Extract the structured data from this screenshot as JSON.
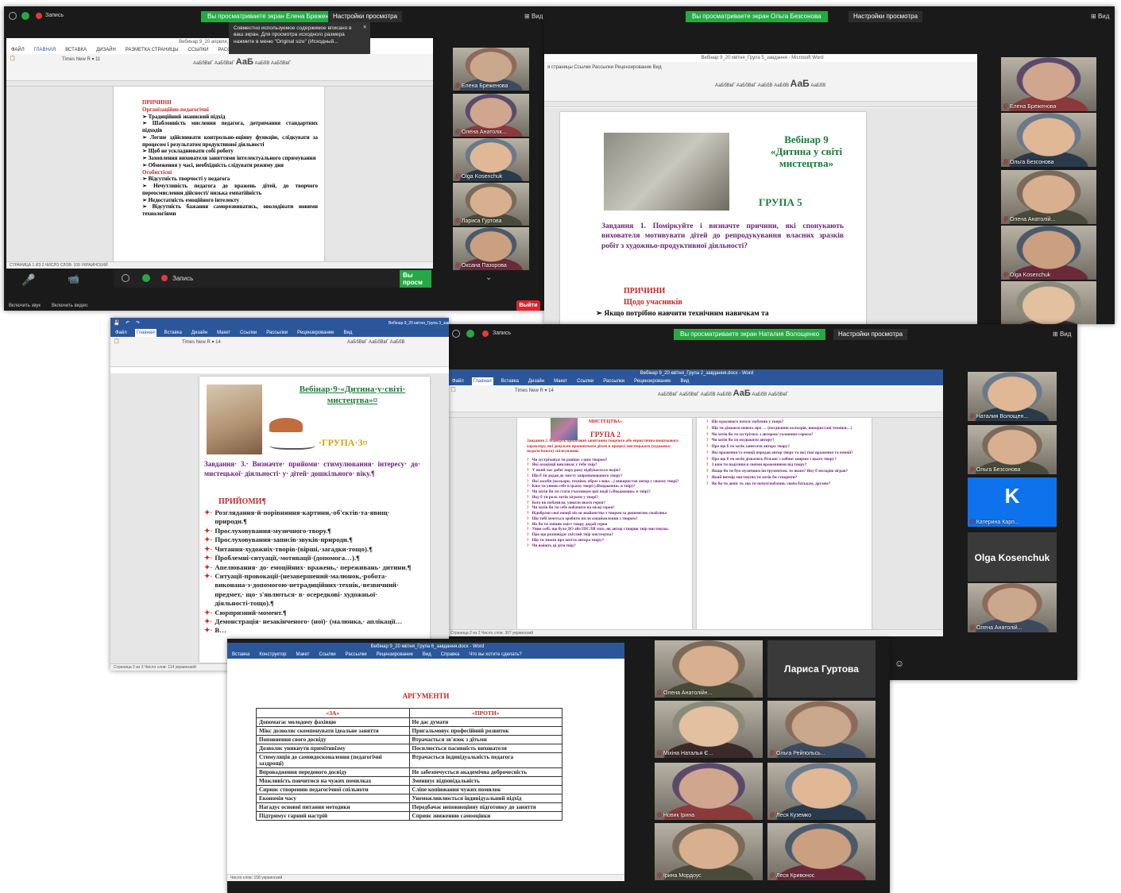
{
  "zoom": {
    "banner_prefix": "Ви просматриваете экран",
    "view_label": "Вид",
    "view_settings": "Настройки просмотра",
    "record": "Запись",
    "exit": "Выйти",
    "reactions": "акции",
    "mute": "Включить звук",
    "video": "Включить видео",
    "tooltip": "Совместно используемое содержимое вписано в ваш экран. Для просмотра исходного размера нажмите в меню \"Original size\" (Исходный..."
  },
  "win1": {
    "banner": "Вы просматриваете экран Елена Бреженова",
    "doc_title": "Вебинар 9_20 апреля, группа 4 - Word",
    "tabs": [
      "ФАЙЛ",
      "ГЛАВНАЯ",
      "ВСТАВКА",
      "ДИЗАЙН",
      "РАЗМЕТКА СТРАНИЦЫ",
      "ССЫЛКИ",
      "РАССЫЛКИ",
      "РЕЦЕНЗИРОВАНИЕ",
      "ВИД"
    ],
    "doc_lines": [
      {
        "t": "ПРИЧИНИ",
        "c": "red"
      },
      {
        "t": "Організаційно-педагогічні",
        "c": "red"
      },
      {
        "t": "➢  Традиційний знаннєвий підхід",
        "c": ""
      },
      {
        "t": "➢  Шаблонність мислення педагога, дотримання стандартних підходів",
        "c": ""
      },
      {
        "t": "➢  Легше здійснювати контрольно-оцінну функцію, слідкувати за процесом і результатом продуктивної діяльності",
        "c": ""
      },
      {
        "t": "➢  Щоб не ускладнювати собі роботу",
        "c": ""
      },
      {
        "t": "➢  Захоплення вихователя заняттями інтелектуального спрямування",
        "c": ""
      },
      {
        "t": "➢  Обмеження у часі, необхідність слідувати режиму дня",
        "c": ""
      },
      {
        "t": "Особистісні",
        "c": "red"
      },
      {
        "t": "➢  Відсутність творчості у педагога",
        "c": ""
      },
      {
        "t": "➢  Нечутливість педагога до вражень дітей, до творчого переосмислення дійсності/ низька емпатійність",
        "c": ""
      },
      {
        "t": "➢  Недостатність емоційного інтелекту",
        "c": ""
      },
      {
        "t": "➢  Відсутність бажання саморозвиватись, оволодівати новими технологіями",
        "c": ""
      }
    ],
    "participants": [
      "Елена Бреженова",
      "Олена Анатолік...",
      "Olga Kosenchuk",
      "Лариса Гуртова",
      "Оксана Пазорова"
    ]
  },
  "win2": {
    "banner": "Вы просматриваете экран Ольга Безсонова",
    "doc_title": "Вебінар 9_20 квітня_Група 5_завдання - Microsoft Word",
    "doc": {
      "title1": "Вебінар 9",
      "title2": "«Дитина у світі мистецтва»",
      "group": "ГРУПА 5",
      "task": "Завдання 1. Поміркуйте і визначте причини, які спонукають вихователя мотивувати дітей до репродукування власних зразків робіт з художньо-продуктивної діяльності?",
      "causes": "ПРИЧИНИ",
      "sub": "Щодо учасників",
      "line": "➢ Якщо потрібно навчити технічним навичкам та"
    },
    "participants": [
      "Елена Бреженова",
      "Ольга Безсонова",
      "Олена Анатолій...",
      "Olga Kosenchuk",
      ""
    ]
  },
  "win3": {
    "doc_title": "Вебінар 9_20 квітня_Група 3_завдання - Word",
    "tabs": [
      "Файл",
      "Главная",
      "Вставка",
      "Дизайн",
      "Макет",
      "Ссылки",
      "Рассылки",
      "Рецензирование",
      "Вид"
    ],
    "doc": {
      "title": "Вебінар·9·«Дитина·у·світі· мистецтва»¤",
      "group": "·ГРУПА·3¤",
      "task": "Завдання· 3.· Визначте· прийоми· стимулювання· інтересу· до· мистецької· діяльності· у· дітей· дошкільного· віку.¶",
      "head": "ПРИЙОМИ¶",
      "items": [
        "Розглядання·й·порівняння·картини,·об'єктів·та·явищ· природи.¶",
        "Прослуховування·музичного·твору.¶",
        "Прослуховування·записів·звуків·природи.¶",
        "Читання·художніх·творів·(вірші,·загадки·тощо).¶",
        "Проблемні·ситуації,·мотивації·(допомога…).¶",
        "Апелювання· до· емоційних· вражень,· переживань· дитини.¶",
        "Ситуації-провокації·(незавершений·малюнок,·робота· виконана·з·допомогою·нетрадиційних·технік,·незвичний· предмет,· що· з'явлються· в· осередкові· художньої· діяльності·тощо).¶",
        "Сюрпризний·момент.¶",
        "Демонстрація· незакінченого· (ної)· (малюнка,· аплікації…",
        "В…"
      ]
    },
    "status": "Страница 2 из 3    Число слов: 114    украинский"
  },
  "win4": {
    "banner": "Вы просматриваете экран Наталия Волощенко",
    "doc_title": "Вебінар 9_20 квітня_Група 2_завдання.docx - Word",
    "tabs": [
      "Файл",
      "Главная",
      "Вставка",
      "Дизайн",
      "Макет",
      "Ссылки",
      "Рассылки",
      "Рецензирование",
      "Вид"
    ],
    "left_col": {
      "head": "МИСТЕЦТВА»",
      "group": "ГРУПА 2",
      "task": "Завдання 2. Наведіть орієнтовні запитання творчого або евристично-пошукового характеру, які доцільно пропонувати дітям в процесі мистецького (художньо-педагогічного) спілкування.",
      "qs": [
        "Чи зустрічався ти раніше з цим твором?",
        "Які асоціації викликає у тебе твір?",
        "У який час доби/ пору року відбувається подія?",
        "Що б ти додав до змісту запропонованого твору?",
        "Які засоби (кольори, техніки, образ слова…) використав автор у своєму творі?",
        "Ким ти уявив себе в цьому творі («Входження» в твір)?",
        "Чи хотів би ти стати учасником цієї події («Входження» в твір)?",
        "Яку б ти роль хотів зіграти у творі?",
        "Кого ви побачили, уявили якого героя?",
        "Чи хотів би ти себе побачити на місці героя?",
        "Відобрази свої емоції після знайомства з твором за допомогою смайлика",
        "Що тобі хочеться зробити після ознайомлення з твором?",
        "Як би ти змінив зміст твору, додай героя",
        "Уяви собі, що було ДО або ПІСЛЯ того, як автор створив твір мистецтва.",
        "Про що розповідає світлий твір мистецтва?",
        "Що ти знаєш про життя автора твору?",
        "Чи вміють ці діти твір?"
      ]
    },
    "right_col": [
      "Що красивого почув/ побачив у творі?",
      "Що ти дізнався нового про … (поєднання кольорів, використані техніки…)",
      "Чи хотів би ти зустрітись з автором/ головним героєм?",
      "Чи хотів би ти охудожити автору?",
      "Про що б ти хотів запитати автора твору?",
      "Які враження та емоції передав автор твору та які твої враження та емоції?",
      "Про що б ти хотів дізнатись більше/ слабше/ ширше з цього твору?",
      "З ким ти поділишся своїми враженнями від твору?",
      "Якщо би ти був музичним інструментом, то яким? Яку б мелодію зіграв?",
      "Який витвір мистецтва ти хотів би створити?",
      "Як би ти допіс те, що ти почув/побачив, своїм батькам, друзям?"
    ],
    "status": "Страница 2 из 2    Число слов: 307    украинский",
    "participants": [
      "Наталия Волощен...",
      "Ольга Безсонова",
      "Катерина Карп...",
      "Olga Kosenchuk",
      "Олена Анатолій..."
    ],
    "k_letter": "K"
  },
  "win5": {
    "doc_title": "Вебінар 9_20 квітня_Група 6_завдання.docx - Word",
    "tabs": [
      "Вставка",
      "Конструктор",
      "Макет",
      "Ссылки",
      "Рассылки",
      "Рецензирование",
      "Вид",
      "Справка",
      "Что вы хотите сделать?"
    ],
    "heading": "АРГУМЕНТИ",
    "col_pro": "«ЗА»",
    "col_con": "«ПРОТИ»",
    "rows": [
      [
        "Допомагає молодому фахівцю",
        "Не дає думати"
      ],
      [
        "Мікс дозволяє скомпонувати ідеальне заняття",
        "Пригальмовує професійний розвиток"
      ],
      [
        "Поповнення свого досвіду",
        "Втрачається зв'язок з дітьми"
      ],
      [
        "Дозволяє уникнути примітивізму",
        "Посилюється пасивність вихователя"
      ],
      [
        "Стимуляція до самовдосконалення (педагогічні заздрощі)",
        "Втрачається індивідуальність педагога"
      ],
      [
        "Впровадження передового досвіду",
        "Не забезпечується академічна доброчесність"
      ],
      [
        "Можливість повчитися на чужих помилках",
        "Зменшує відповідальність"
      ],
      [
        "Сприяє створенню педагогічної спільноти",
        "Сліпе копіювання чужих помилок"
      ],
      [
        "Економія часу",
        "Унеможливлюється індивідуальний підхід"
      ],
      [
        "Нагадує основні питання методики",
        "Передбачає неповноцінну підготовку до заняття"
      ],
      [
        "Підтримує гарний настрій",
        "Сприяє зниженню самооцінки"
      ]
    ],
    "status": "Число слов: 158    украинский"
  },
  "gallery": {
    "participants": [
      "Олена Анатолійн...",
      "Лариса Гуртова",
      "Міхіна Наталья Є...",
      "Ольга Рейпольсь...",
      "Новик Ірина",
      "Леся Куземко",
      "Ірина Мордоус",
      "Леся Кривонос"
    ]
  },
  "colors": {
    "zoom_green": "#27a844",
    "word_blue": "#2b579a",
    "active_outline": "#d6e84a",
    "exit_red": "#d9262b"
  }
}
